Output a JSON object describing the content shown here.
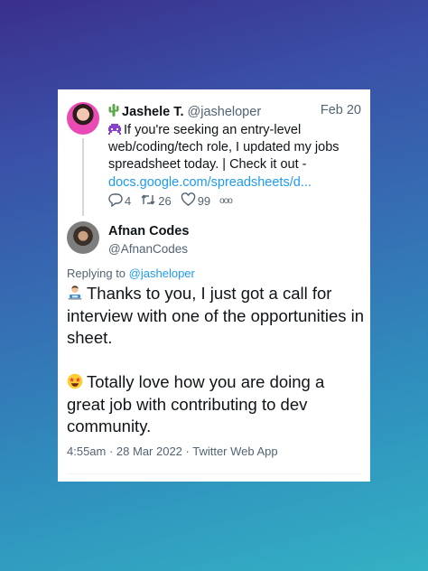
{
  "quoted_tweet": {
    "author_name": "Jashele T.",
    "author_handle": "@jasheloper",
    "date": "Feb 20",
    "text": "If you're seeking an entry-level web/coding/tech role, I updated my jobs spreadsheet today. | Check it out -",
    "link": "docs.google.com/spreadsheets/d...",
    "reply_count": "4",
    "retweet_count": "26",
    "like_count": "99",
    "more": "ooo"
  },
  "tweet": {
    "author_name": "Afnan Codes",
    "author_handle": "@AfnanCodes",
    "replying_prefix": "Replying to",
    "replying_to": "@jasheloper",
    "paragraph_1": "Thanks to you, I just got a call for interview with one of the opportunities in sheet.",
    "paragraph_2": "Totally love how you are doing a great job with contributing to dev community.",
    "timestamp": "4:55am · 28 Mar 2022 · Twitter Web App"
  },
  "colors": {
    "link": "#1d9bf0",
    "secondary_text": "#536471",
    "primary_text": "#0f1419"
  },
  "icons": [
    "cactus-icon",
    "alien-icon",
    "reply-icon",
    "retweet-icon",
    "like-icon",
    "technologist-emoji",
    "star-struck-emoji"
  ]
}
